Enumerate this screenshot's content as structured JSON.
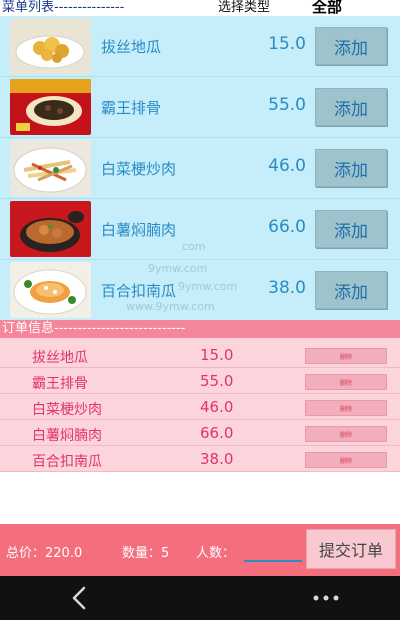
{
  "menu_header": {
    "title": "菜单列表---------------",
    "type_label": "选择类型",
    "all_label": "全部"
  },
  "menu_items": [
    {
      "name": "拔丝地瓜",
      "price": "15.0",
      "add_label": "添加",
      "image": "fried-sweet-potato-dish"
    },
    {
      "name": "霸王排骨",
      "price": "55.0",
      "add_label": "添加",
      "image": "pork-ribs-dish"
    },
    {
      "name": "白菜梗炒肉",
      "price": "46.0",
      "add_label": "添加",
      "image": "stir-fried-cabbage-pork-dish"
    },
    {
      "name": "白薯焖腩肉",
      "price": "66.0",
      "add_label": "添加",
      "image": "braised-pork-claypot-dish"
    },
    {
      "name": "百合扣南瓜",
      "price": "38.0",
      "add_label": "添加",
      "image": "lily-pumpkin-dish"
    }
  ],
  "order_header": "订单信息----------------------------",
  "order_items": [
    {
      "name": "拔丝地瓜",
      "price": "15.0",
      "del_label": "删除"
    },
    {
      "name": "霸王排骨",
      "price": "55.0",
      "del_label": "删除"
    },
    {
      "name": "白菜梗炒肉",
      "price": "46.0",
      "del_label": "删除"
    },
    {
      "name": "白薯焖腩肉",
      "price": "66.0",
      "del_label": "删除"
    },
    {
      "name": "百合扣南瓜",
      "price": "38.0",
      "del_label": "删除"
    }
  ],
  "footer": {
    "total": "总价：220.0",
    "count": "数量：5",
    "people_label": "人数：",
    "people_value": "",
    "submit_label": "提交订单"
  },
  "watermark": [
    "com",
    "9ymw.com",
    "9ymw.com",
    "www.9ymw.com"
  ],
  "colors": {
    "menu_bg": "#c6eefa",
    "order_header_bg": "#f5879a",
    "order_bg": "#fcd4dc",
    "footer_bg": "#f46e7d",
    "accent_blue": "#2a8cc4",
    "accent_pink": "#e0356a"
  },
  "nav": {
    "back_icon": "back-chevron-icon",
    "more_icon": "more-dots-icon"
  }
}
